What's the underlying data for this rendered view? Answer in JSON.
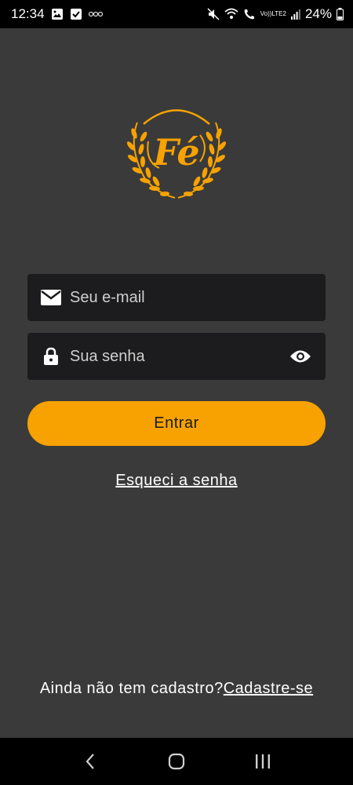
{
  "status_bar": {
    "time": "12:34",
    "battery": "24%",
    "network_top": "Vo))",
    "network_bottom": "LTE2"
  },
  "logo": {
    "text": "Fé",
    "color": "#f7a200"
  },
  "login_form": {
    "email_placeholder": "Seu e-mail",
    "password_placeholder": "Sua senha",
    "submit_label": "Entrar",
    "forgot_password_label": "Esqueci a senha"
  },
  "signup": {
    "prompt": "Ainda não tem cadastro?",
    "link_label": "Cadastre-se"
  },
  "icons": {
    "email": "envelope-icon",
    "password": "lock-icon",
    "toggle_visibility": "eye-icon"
  },
  "colors": {
    "background": "#3a3a3a",
    "field_background": "#1c1b1d",
    "accent": "#f7a200"
  }
}
